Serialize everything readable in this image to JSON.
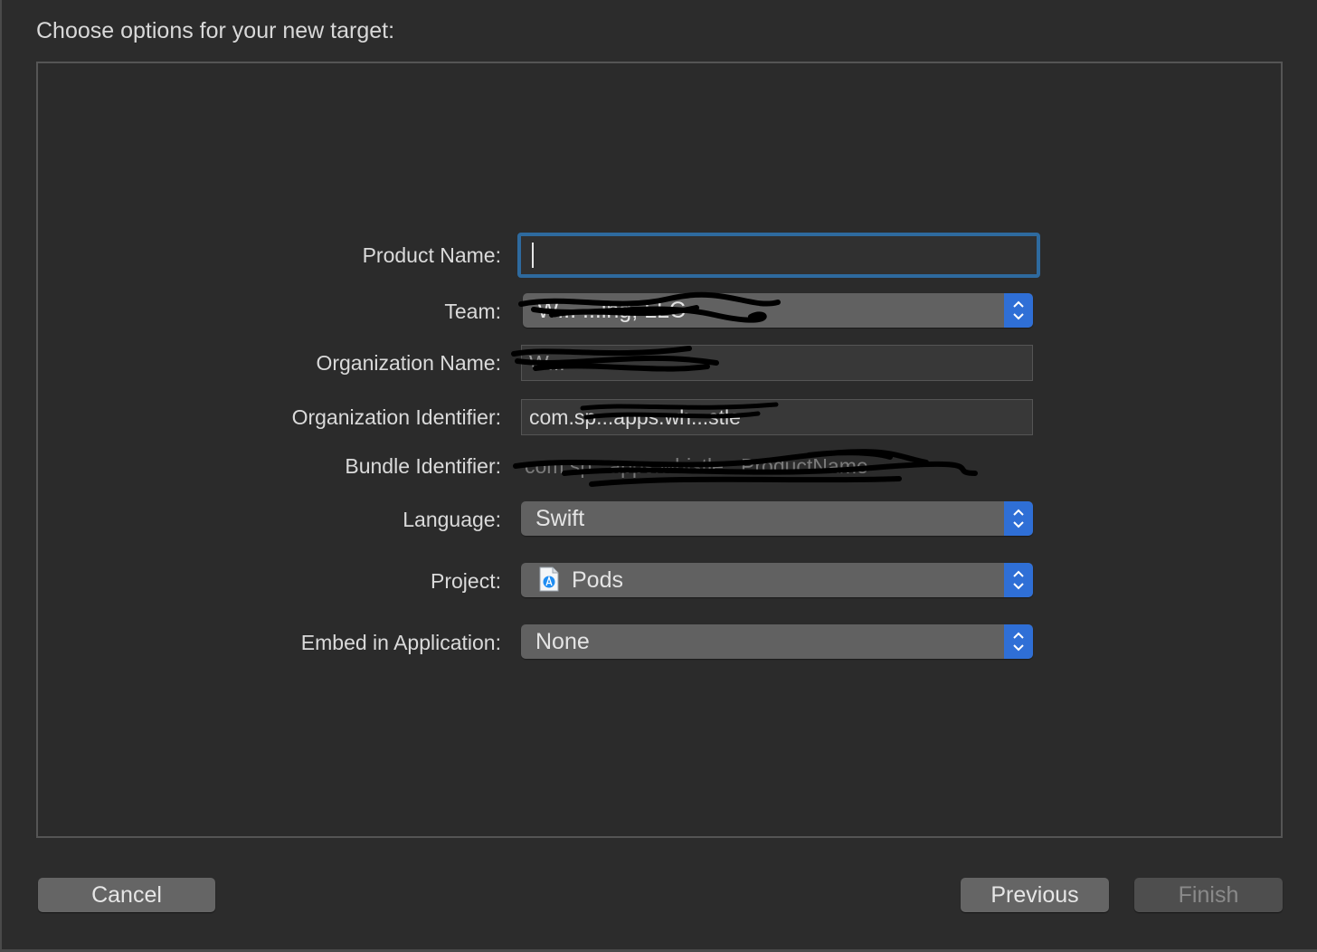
{
  "dialog": {
    "heading": "Choose options for your new target:"
  },
  "form": {
    "product_name": {
      "label": "Product Name:",
      "value": ""
    },
    "team": {
      "label": "Team:",
      "value": "W... ...ing, LLC"
    },
    "organization_name": {
      "label": "Organization Name:",
      "value": "W..."
    },
    "organization_identifier": {
      "label": "Organization Identifier:",
      "value": "com.sp...apps.wh...stle"
    },
    "bundle_identifier": {
      "label": "Bundle Identifier:",
      "value": "com.sp...apps.whistle...ProductName"
    },
    "language": {
      "label": "Language:",
      "value": "Swift"
    },
    "project": {
      "label": "Project:",
      "value": "Pods",
      "icon": "xcode-project-file-icon"
    },
    "embed": {
      "label": "Embed in Application:",
      "value": "None"
    }
  },
  "buttons": {
    "cancel": "Cancel",
    "previous": "Previous",
    "finish": "Finish"
  },
  "colors": {
    "background": "#2c2c2c",
    "accent": "#2f6fd6",
    "focus_ring": "#2e6a9e",
    "popup": "#616161"
  }
}
